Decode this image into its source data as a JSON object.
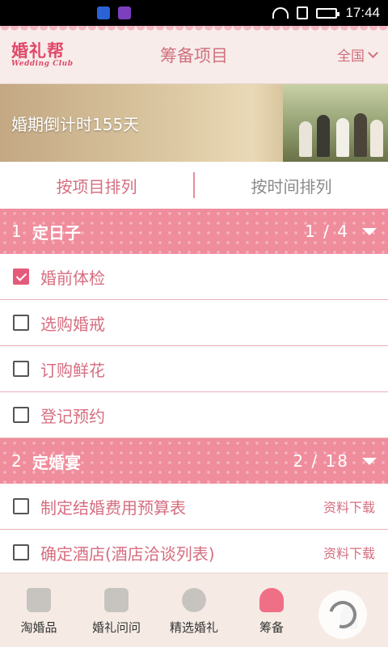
{
  "status_bar": {
    "time": "17:44",
    "icons": [
      "shield-icon",
      "gallery-icon",
      "wifi-icon",
      "sim-icon",
      "battery-icon"
    ]
  },
  "header": {
    "logo_cn": "婚礼帮",
    "logo_en": "Wedding Club",
    "title": "筹备项目",
    "region": "全国"
  },
  "banner": {
    "countdown": "婚期倒计时155天"
  },
  "tabs": [
    {
      "label": "按项目排列",
      "active": true
    },
    {
      "label": "按时间排列",
      "active": false
    }
  ],
  "groups": [
    {
      "number": "1",
      "name": "定日子",
      "progress": "1 / 4",
      "tasks": [
        {
          "label": "婚前体检",
          "checked": true,
          "action": ""
        },
        {
          "label": "选购婚戒",
          "checked": false,
          "action": ""
        },
        {
          "label": "订购鲜花",
          "checked": false,
          "action": ""
        },
        {
          "label": "登记预约",
          "checked": false,
          "action": ""
        }
      ]
    },
    {
      "number": "2",
      "name": "定婚宴",
      "progress": "2 / 18",
      "tasks": [
        {
          "label": "制定结婚费用预算表",
          "checked": false,
          "action": "资料下载"
        },
        {
          "label": "确定酒店(酒店洽谈列表)",
          "checked": false,
          "action": "资料下载"
        }
      ]
    }
  ],
  "bottom_nav": [
    {
      "label": "淘婚品",
      "icon": "shopping-bag-icon"
    },
    {
      "label": "婚礼问问",
      "icon": "chat-bubbles-icon"
    },
    {
      "label": "精选婚礼",
      "icon": "balloons-icon"
    },
    {
      "label": "筹备",
      "icon": "hearts-icon"
    },
    {
      "label": "",
      "icon": "user-icon"
    }
  ],
  "colors": {
    "accent": "#d66e80",
    "group_header": "#ef8d9c",
    "checkbox_checked": "#e55a7a"
  }
}
